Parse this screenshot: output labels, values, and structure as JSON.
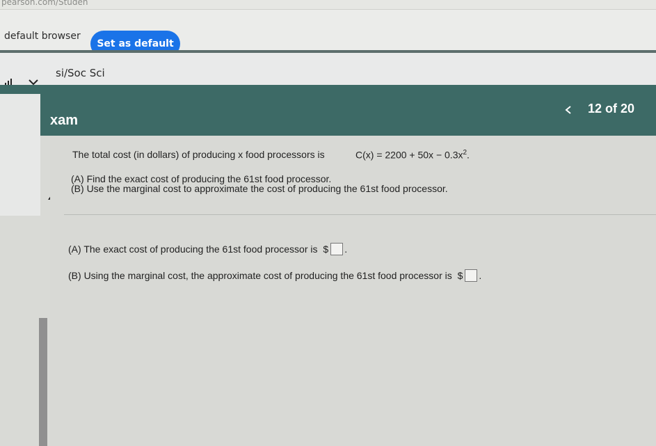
{
  "browser": {
    "url": "pearson.com/Studen",
    "banner_text": "default browser",
    "set_default_label": "Set as default"
  },
  "course": {
    "name": "si/Soc Sci"
  },
  "exam": {
    "title": "xam",
    "progress": "12 of 20"
  },
  "question": {
    "problem_text": "The total cost (in dollars) of producing x food processors is",
    "formula_base": "C(x) = 2200 + 50x − 0.3x",
    "formula_exponent": "2",
    "formula_end": ".",
    "parts": [
      {
        "label": "(A)",
        "text": "Find the exact cost of producing the 61st food processor."
      },
      {
        "label": "(B)",
        "text": "Use the marginal cost to approximate the cost of producing the 61st food processor."
      }
    ],
    "answers": [
      {
        "label": "(A)",
        "text": "The exact cost of producing the 61st food processor is",
        "currency": "$",
        "end": "."
      },
      {
        "label": "(B)",
        "text": "Using the marginal cost, the approximate cost of producing the 61st food processor is",
        "currency": "$",
        "end": "."
      }
    ]
  },
  "icons": {
    "signal": "signal-icon",
    "chevron": "chevron-down-icon",
    "previous": "chevron-left-icon"
  },
  "colors": {
    "header": "#3d6a66",
    "default_button": "#1a73e8"
  }
}
